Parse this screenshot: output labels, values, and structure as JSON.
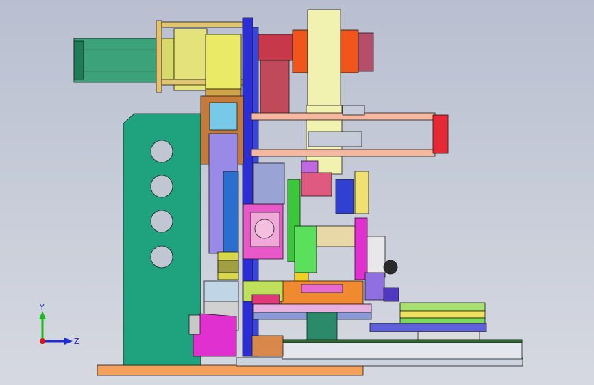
{
  "viewport": {
    "background_top": "#b9bfd0",
    "background_bottom": "#d6d9e1"
  },
  "triad": {
    "y_label": "Y",
    "z_label": "Z",
    "y_color": "#1fb81f",
    "z_color": "#1e2bd6",
    "origin_color": "#d21a1a"
  }
}
